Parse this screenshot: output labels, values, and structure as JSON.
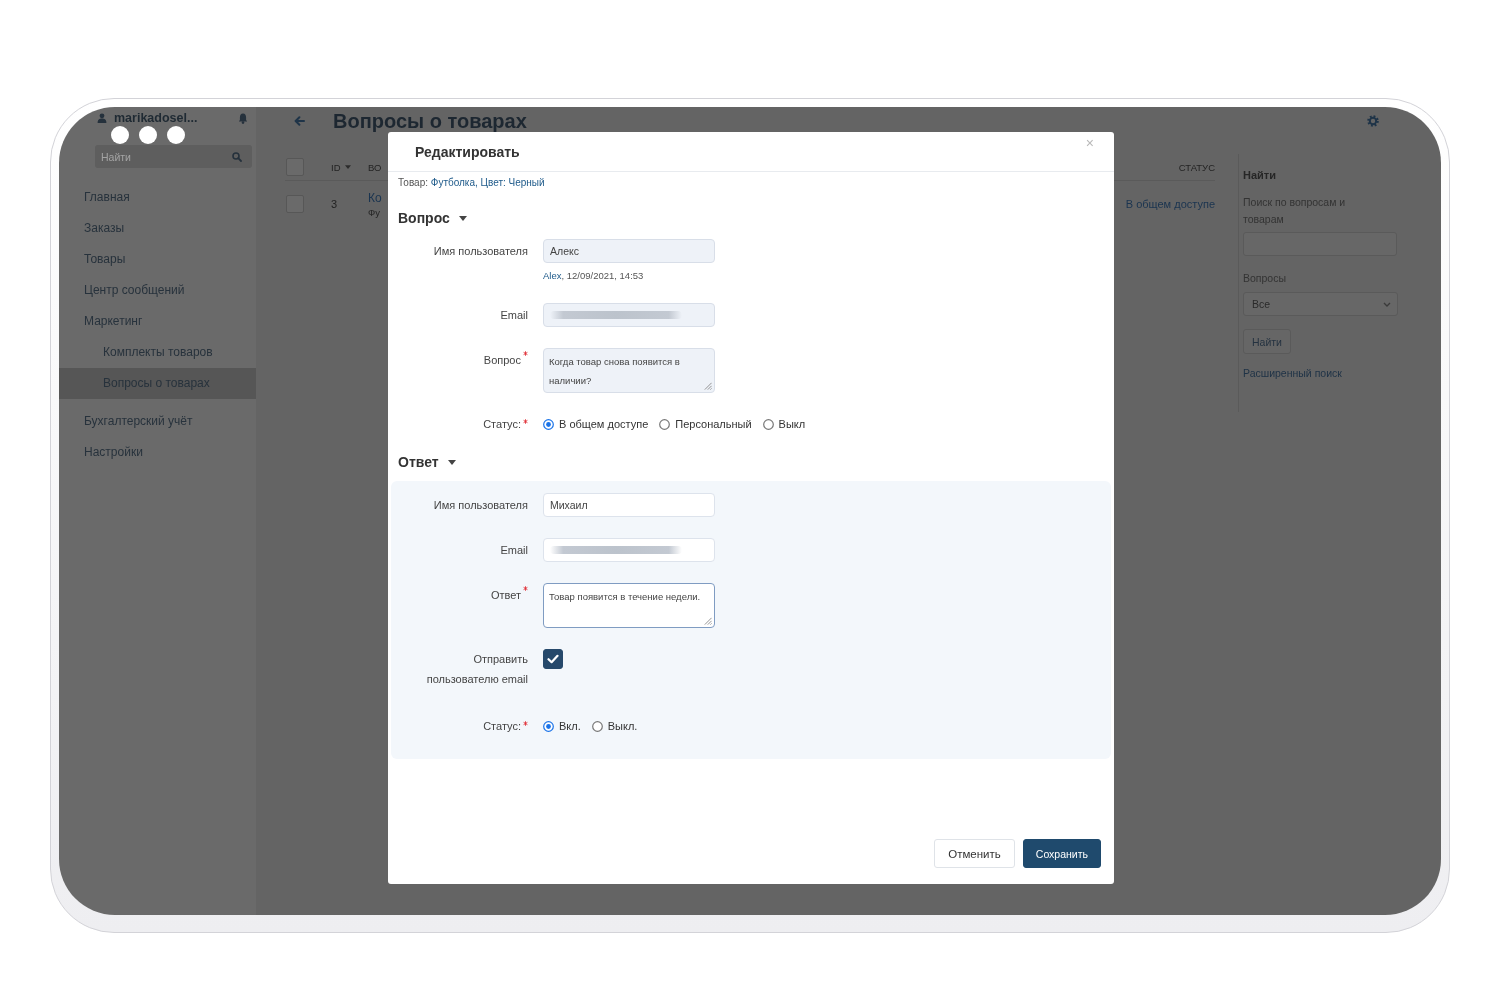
{
  "sidebar": {
    "user": "marikadosel...",
    "search": {
      "placeholder": "Найти"
    },
    "items": [
      {
        "label": "Главная",
        "selected": false
      },
      {
        "label": "Заказы",
        "selected": false
      },
      {
        "label": "Товары",
        "selected": false
      },
      {
        "label": "Центр сообщений",
        "selected": false
      },
      {
        "label": "Маркетинг",
        "selected": false,
        "children": [
          {
            "label": "Комплекты товаров",
            "selected": false
          },
          {
            "label": "Вопросы о товарах",
            "selected": true
          }
        ]
      },
      {
        "label": "Бухгалтерский учёт",
        "selected": false
      },
      {
        "label": "Настройки",
        "selected": false
      }
    ]
  },
  "page": {
    "title": "Вопросы о товарах"
  },
  "table": {
    "header_checked": false,
    "columns": [
      {
        "label": "ID",
        "sorted": true
      },
      {
        "label": "ВО",
        "sorted": false
      },
      {
        "label": "СТАТУС",
        "sorted": false
      }
    ],
    "rows": [
      {
        "checked": false,
        "id": "3",
        "column_2": [
          "Ко",
          "Фу"
        ],
        "status": "В общем доступе"
      }
    ]
  },
  "filter": {
    "title": "Найти",
    "search": {
      "label": "Поиск по вопросам и товарам"
    },
    "questions": {
      "label": "Вопросы",
      "value": "Все"
    },
    "button": "Найти",
    "advanced_link": "Расширенный поиск"
  },
  "modal": {
    "title": "Редактировать",
    "close": "×",
    "product": {
      "label": "Товар:",
      "link": "Футболка, Цвет: Черный"
    },
    "sections": [
      {
        "title": "Вопрос",
        "kind": "plain",
        "expanded": true,
        "fields": [
          {
            "kind": "input",
            "label": "Имя пользователя",
            "required": false,
            "readonly": true,
            "value": "Алекс",
            "meta": {
              "author": "Alex",
              "text": ", 12/09/2021, 14:53"
            }
          },
          {
            "kind": "input",
            "label": "Email",
            "required": false,
            "readonly": true,
            "redacted": true
          },
          {
            "kind": "textarea",
            "label": "Вопрос",
            "required": true,
            "readonly": true,
            "focused": false,
            "value": "Когда товар снова появится в наличии?"
          },
          {
            "kind": "radio",
            "label": "Статус:",
            "required": true,
            "options": [
              {
                "label": "В общем доступе",
                "selected": true
              },
              {
                "label": "Персональный",
                "selected": false
              },
              {
                "label": "Выкл",
                "selected": false
              }
            ]
          }
        ]
      },
      {
        "title": "Ответ",
        "kind": "panel",
        "expanded": true,
        "fields": [
          {
            "kind": "input",
            "label": "Имя пользователя",
            "required": false,
            "readonly": false,
            "value": "Михаил"
          },
          {
            "kind": "input",
            "label": "Email",
            "required": false,
            "readonly": false,
            "redacted": true
          },
          {
            "kind": "textarea",
            "label": "Ответ",
            "required": true,
            "readonly": false,
            "focused": true,
            "value": "Товар появится в течение недели."
          },
          {
            "kind": "checkbox",
            "label": "Отправить пользователю email",
            "required": false,
            "checked": true
          },
          {
            "kind": "radio",
            "label": "Статус:",
            "required": true,
            "options": [
              {
                "label": "Вкл.",
                "selected": true
              },
              {
                "label": "Выкл.",
                "selected": false
              }
            ]
          }
        ]
      }
    ],
    "buttons": [
      {
        "label": "Отменить",
        "kind": "secondary"
      },
      {
        "label": "Сохранить",
        "kind": "primary"
      }
    ]
  }
}
